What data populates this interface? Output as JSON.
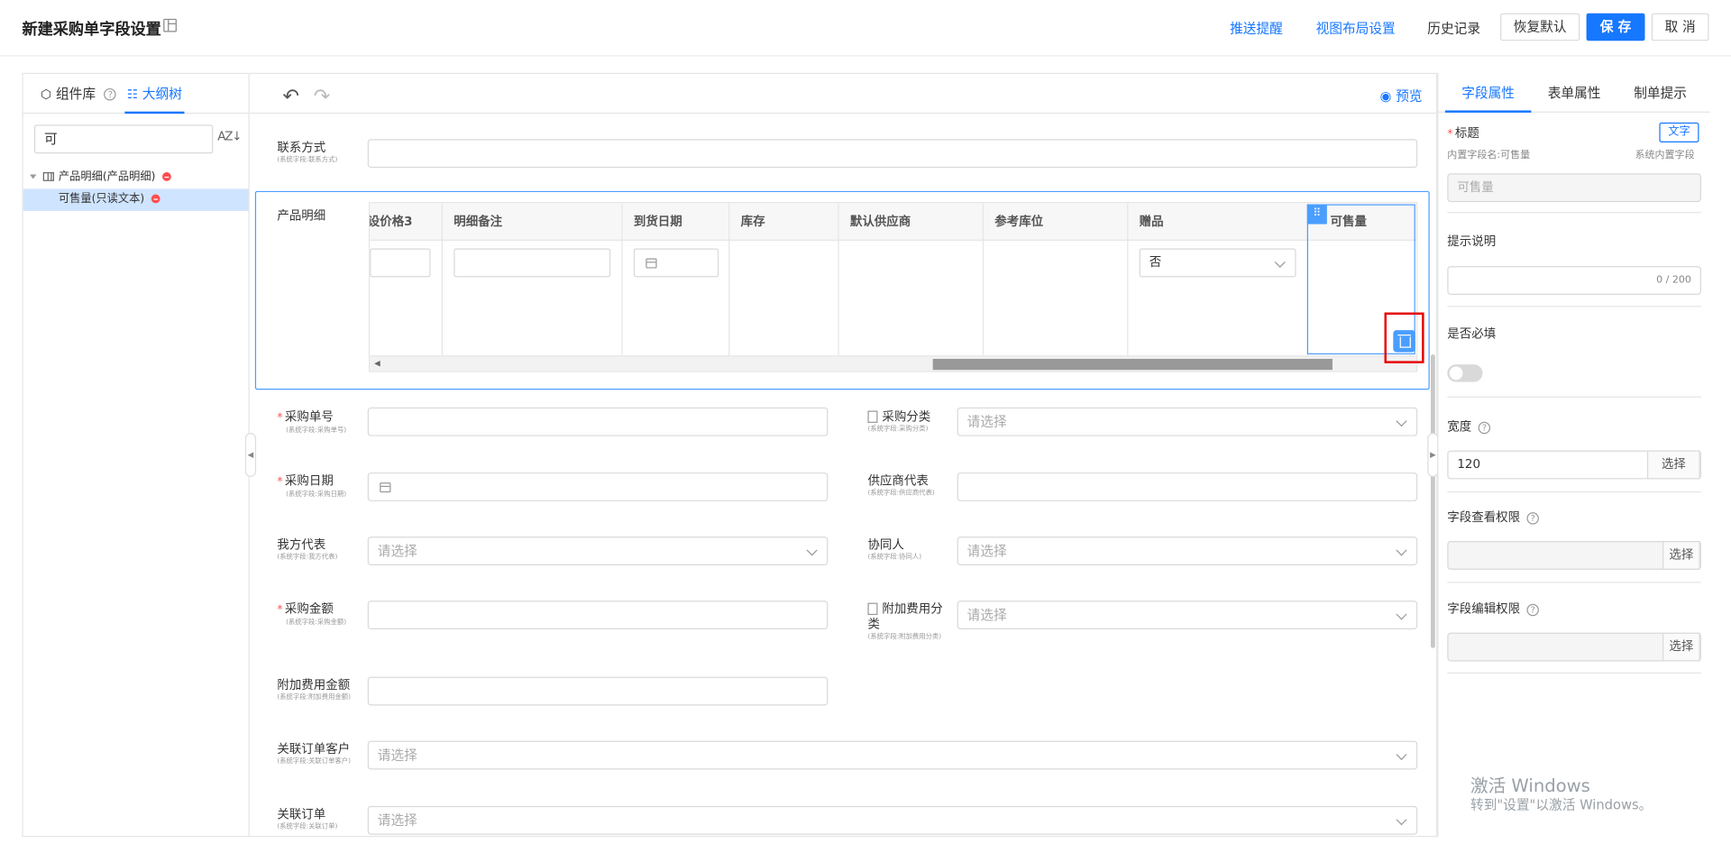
{
  "header": {
    "title": "新建采购单字段设置",
    "links": [
      "推送提醒",
      "视图布局设置",
      "历史记录"
    ],
    "restore_label": "恢复默认",
    "save_label": "保 存",
    "cancel_label": "取 消"
  },
  "left_panel": {
    "tab_components": "组件库",
    "tab_outline": "大纲树",
    "search_value": "可",
    "sort_icon": "AZ↓",
    "tree": [
      {
        "label": "产品明细(产品明细)"
      },
      {
        "label": "可售量(只读文本)"
      }
    ]
  },
  "center": {
    "preview_label": "预览",
    "fields_top": [
      {
        "label": "联系方式",
        "sub": "(系统字段:联系方式)"
      }
    ],
    "detail": {
      "label": "产品明细",
      "columns": [
        "设价格3",
        "明细备注",
        "到货日期",
        "库存",
        "默认供应商",
        "参考库位",
        "赠品",
        "可售量"
      ],
      "gift_value": "否"
    },
    "form_rows": [
      {
        "left": {
          "label": "采购单号",
          "sub": "(系统字段:采购单号)",
          "required": "*",
          "placeholder": ""
        },
        "right": {
          "label": "采购分类",
          "sub": "(系统字段:采购分类)",
          "placeholder": "请选择"
        }
      },
      {
        "left": {
          "label": "采购日期",
          "sub": "(系统字段:采购日期)",
          "required": "*",
          "placeholder": ""
        },
        "right": {
          "label": "供应商代表",
          "sub": "(系统字段:供应商代表)",
          "placeholder": ""
        }
      },
      {
        "left": {
          "label": "我方代表",
          "sub": "(系统字段:我方代表)",
          "placeholder": "请选择"
        },
        "right": {
          "label": "协同人",
          "sub": "(系统字段:协同人)",
          "placeholder": "请选择"
        }
      },
      {
        "left": {
          "label": "采购金额",
          "sub": "(系统字段:采购金额)",
          "required": "*",
          "placeholder": ""
        },
        "right": {
          "label": "附加费用分类",
          "sub": "(系统字段:附加费用分类)",
          "placeholder": "请选择"
        }
      }
    ],
    "extra_amount": {
      "label": "附加费用金额",
      "sub": "(系统字段:附加费用金额)"
    },
    "linked_customer": {
      "label": "关联订单客户",
      "sub": "(系统字段:关联订单客户)",
      "placeholder": "请选择"
    },
    "linked_order": {
      "label": "关联订单",
      "sub": "(系统字段:关联订单)",
      "placeholder": "请选择"
    }
  },
  "right_panel": {
    "tabs": [
      "字段属性",
      "表单属性",
      "制单提示"
    ],
    "title_label": "标题",
    "title_tag": "文字",
    "builtin_name": "内置字段名:可售量",
    "system_field": "系统内置字段",
    "title_value": "可售量",
    "hint_label": "提示说明",
    "hint_counter": "0 / 200",
    "required_label": "是否必填",
    "width_label": "宽度",
    "width_value": "120",
    "select_label": "选择",
    "view_perm_label": "字段查看权限",
    "edit_perm_label": "字段编辑权限"
  },
  "watermark": {
    "line1": "激活 Windows",
    "line2": "转到\"设置\"以激活 Windows。"
  },
  "colors": {
    "accent": "#1677ff",
    "required": "#ff4d4f",
    "highlight": "#e60000"
  }
}
